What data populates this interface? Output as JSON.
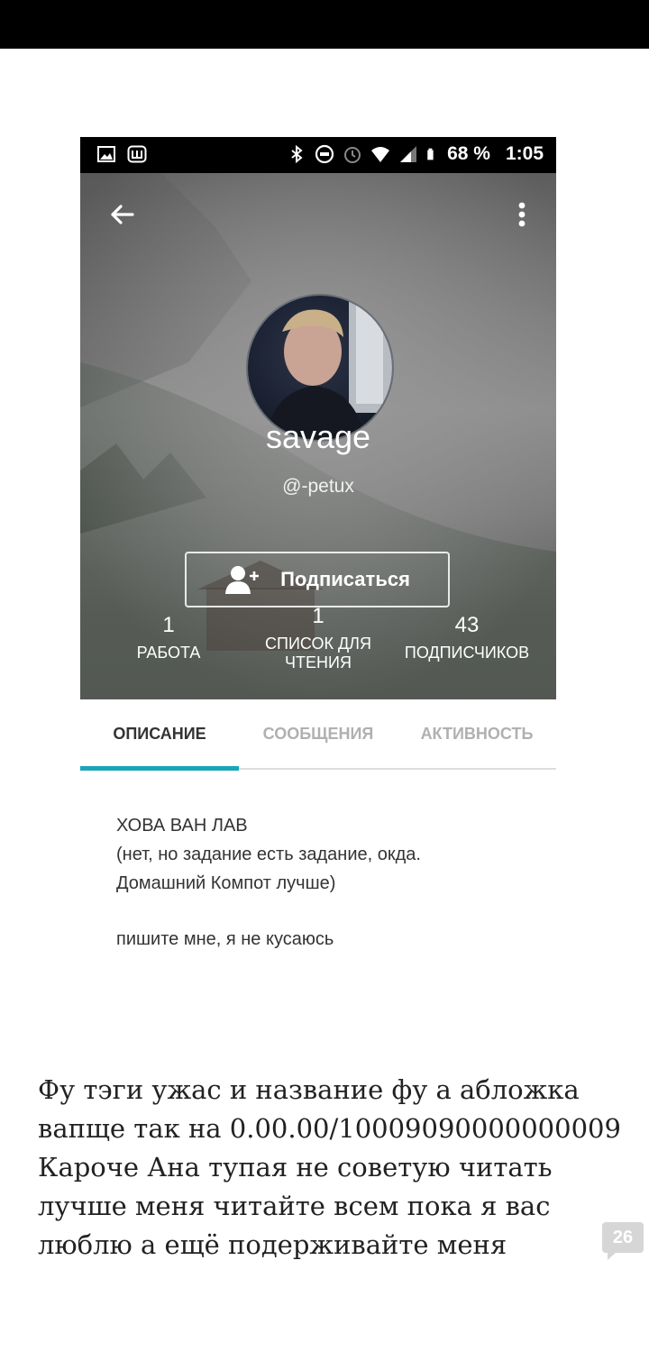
{
  "status_bar": {
    "battery": "68 %",
    "time": "1:05",
    "left_icons": [
      "image-icon",
      "app-icon"
    ],
    "right_icons": [
      "bluetooth-icon",
      "dnd-icon",
      "alarm-icon",
      "wifi-icon",
      "signal-icon",
      "battery-icon"
    ]
  },
  "profile": {
    "display_name": "savage",
    "username": "@-petux",
    "follow_label": "Подписаться",
    "stats": [
      {
        "value": "1",
        "label": "РАБОТА"
      },
      {
        "value": "1",
        "label": "СПИСОК ДЛЯ ЧТЕНИЯ"
      },
      {
        "value": "43",
        "label": "ПОДПИСЧИКОВ"
      }
    ]
  },
  "tabs": [
    {
      "label": "ОПИСАНИЕ",
      "active": true
    },
    {
      "label": "СООБЩЕНИЯ",
      "active": false
    },
    {
      "label": "АКТИВНОСТЬ",
      "active": false
    }
  ],
  "description": {
    "lines": [
      "ХОВА ВАН ЛАВ",
      "(нет, но задание есть задание, окда.",
      "Домашний Компот лучше)"
    ],
    "footer_line": "пишите мне, я не кусаюсь"
  },
  "comment": {
    "lines": [
      "Фу тэги ужас и название фу а абложка",
      "вапще так на 0.00.00/10009090000000009",
      "Кароче Ана тупая не советую читать",
      "лучше меня читайте всем пока я вас",
      "люблю а ещё подерживайте меня"
    ],
    "count": "26"
  },
  "colors": {
    "accent": "#1aa5b8",
    "status_bar": "#000000",
    "header_bg": "#7a7a7a",
    "badge": "#d6d6d6"
  }
}
